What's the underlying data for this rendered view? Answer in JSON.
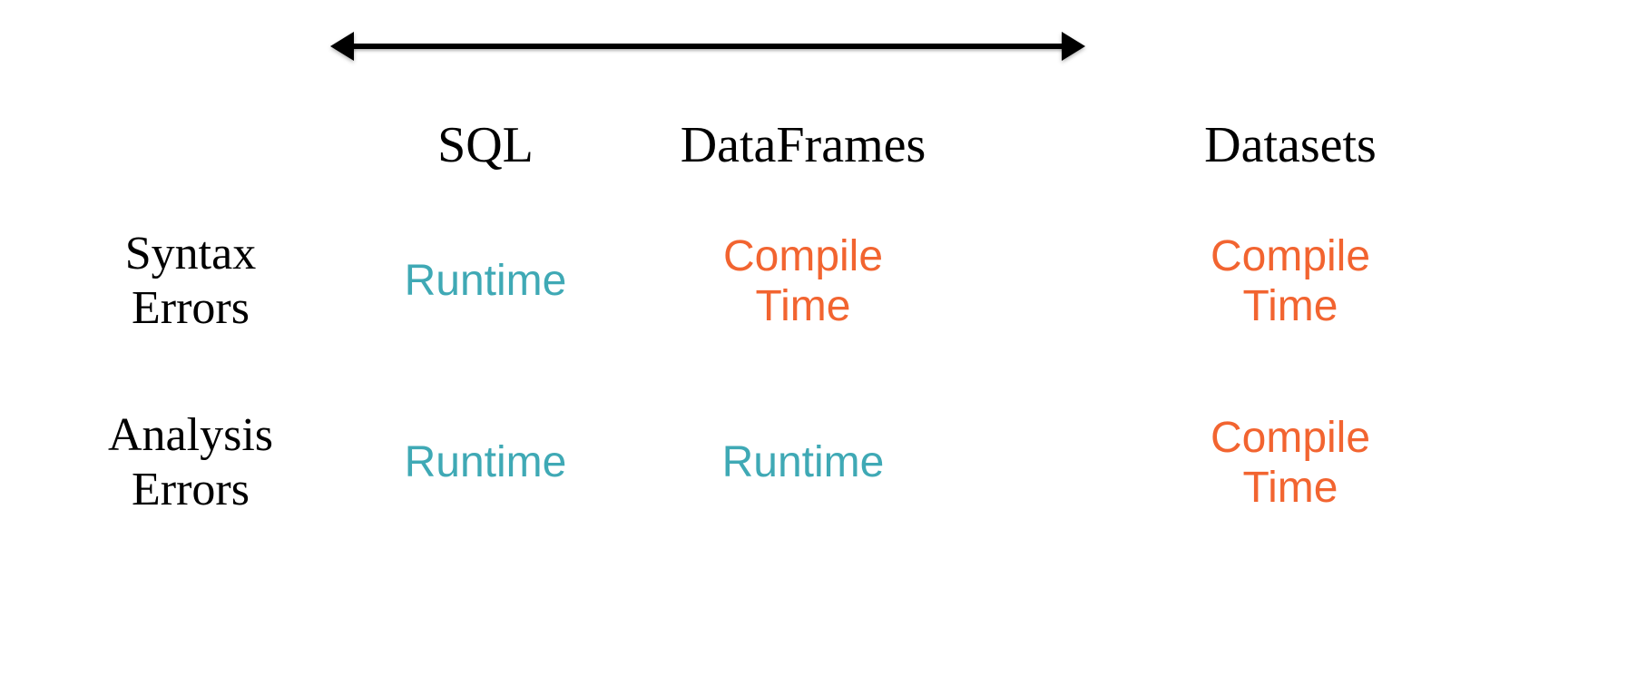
{
  "columns": {
    "c1": "SQL",
    "c2": "DataFrames",
    "c3": "Datasets"
  },
  "rows": {
    "r1": "Syntax\nErrors",
    "r2": "Analysis\nErrors"
  },
  "values": {
    "r1c1": "Runtime",
    "r1c2": "Compile\nTime",
    "r1c3": "Compile\nTime",
    "r2c1": "Runtime",
    "r2c2": "Runtime",
    "r2c3": "Compile\nTime"
  },
  "colors": {
    "runtime": "#3fa9b5",
    "compile": "#f26430"
  }
}
